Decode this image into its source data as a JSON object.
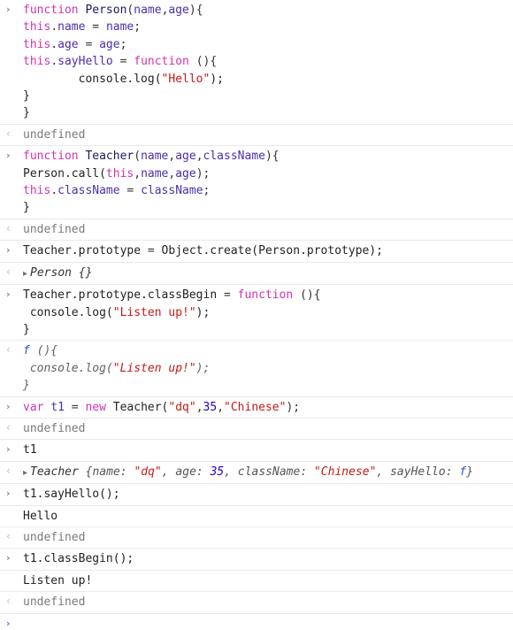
{
  "app": {
    "name": "browser-devtools-console",
    "theme": "light"
  },
  "colors": {
    "background": "#ffffff",
    "keyword": "#d033b5",
    "identifier": "#4b2fa8",
    "function_name": "#1a1a5e",
    "string": "#c41a16",
    "number": "#1c00cf",
    "plain_text": "#222222",
    "result_gray": "#7a7a7a",
    "separator": "#eaeaea",
    "prompt_blue": "#4a7fe0"
  },
  "icons": {
    "input_prompt": "›",
    "output_prompt": "‹",
    "disclosure_triangle": "▸"
  },
  "console": {
    "entries": [
      {
        "kind": "input",
        "gutter": "input-prompt-icon",
        "lines": [
          {
            "tokens": [
              {
                "t": "function",
                "c": "kw"
              },
              {
                "t": " ",
                "c": "plain"
              },
              {
                "t": "Person",
                "c": "fname"
              },
              {
                "t": "(",
                "c": "punct"
              },
              {
                "t": "name",
                "c": "ident"
              },
              {
                "t": ",",
                "c": "punct"
              },
              {
                "t": "age",
                "c": "ident"
              },
              {
                "t": "){",
                "c": "punct"
              }
            ]
          },
          {
            "tokens": [
              {
                "t": "this",
                "c": "kw"
              },
              {
                "t": ".",
                "c": "punct"
              },
              {
                "t": "name",
                "c": "ident"
              },
              {
                "t": " = ",
                "c": "punct"
              },
              {
                "t": "name",
                "c": "ident"
              },
              {
                "t": ";",
                "c": "punct"
              }
            ]
          },
          {
            "tokens": [
              {
                "t": "this",
                "c": "kw"
              },
              {
                "t": ".",
                "c": "punct"
              },
              {
                "t": "age",
                "c": "ident"
              },
              {
                "t": " = ",
                "c": "punct"
              },
              {
                "t": "age",
                "c": "ident"
              },
              {
                "t": ";",
                "c": "punct"
              }
            ]
          },
          {
            "tokens": [
              {
                "t": "this",
                "c": "kw"
              },
              {
                "t": ".",
                "c": "punct"
              },
              {
                "t": "sayHello",
                "c": "ident"
              },
              {
                "t": " = ",
                "c": "punct"
              },
              {
                "t": "function",
                "c": "kw"
              },
              {
                "t": " (){",
                "c": "punct"
              }
            ]
          },
          {
            "tokens": [
              {
                "t": "        console.log(",
                "c": "plain"
              },
              {
                "t": "\"Hello\"",
                "c": "str"
              },
              {
                "t": ");",
                "c": "plain"
              }
            ]
          },
          {
            "tokens": [
              {
                "t": "}",
                "c": "plain"
              }
            ]
          },
          {
            "tokens": [
              {
                "t": "}",
                "c": "plain"
              }
            ]
          }
        ]
      },
      {
        "kind": "result",
        "gutter": "output-prompt-icon",
        "text": "undefined",
        "style": "undefined"
      },
      {
        "kind": "input",
        "gutter": "input-prompt-icon",
        "lines": [
          {
            "tokens": [
              {
                "t": "function",
                "c": "kw"
              },
              {
                "t": " ",
                "c": "plain"
              },
              {
                "t": "Teacher",
                "c": "fname"
              },
              {
                "t": "(",
                "c": "punct"
              },
              {
                "t": "name",
                "c": "ident"
              },
              {
                "t": ",",
                "c": "punct"
              },
              {
                "t": "age",
                "c": "ident"
              },
              {
                "t": ",",
                "c": "punct"
              },
              {
                "t": "className",
                "c": "ident"
              },
              {
                "t": "){",
                "c": "punct"
              }
            ]
          },
          {
            "tokens": [
              {
                "t": "Person.call(",
                "c": "plain"
              },
              {
                "t": "this",
                "c": "kw"
              },
              {
                "t": ",",
                "c": "punct"
              },
              {
                "t": "name",
                "c": "ident"
              },
              {
                "t": ",",
                "c": "punct"
              },
              {
                "t": "age",
                "c": "ident"
              },
              {
                "t": ");",
                "c": "punct"
              }
            ]
          },
          {
            "tokens": [
              {
                "t": "this",
                "c": "kw"
              },
              {
                "t": ".",
                "c": "punct"
              },
              {
                "t": "className",
                "c": "ident"
              },
              {
                "t": " = ",
                "c": "punct"
              },
              {
                "t": "className",
                "c": "ident"
              },
              {
                "t": ";",
                "c": "punct"
              }
            ]
          },
          {
            "tokens": [
              {
                "t": "}",
                "c": "plain"
              }
            ]
          }
        ]
      },
      {
        "kind": "result",
        "gutter": "output-prompt-icon",
        "text": "undefined",
        "style": "undefined"
      },
      {
        "kind": "input",
        "gutter": "input-prompt-icon",
        "lines": [
          {
            "tokens": [
              {
                "t": "Teacher.prototype",
                "c": "plain"
              },
              {
                "t": " = ",
                "c": "punct"
              },
              {
                "t": "Object.create(Person.prototype);",
                "c": "plain"
              }
            ]
          }
        ]
      },
      {
        "kind": "result-object",
        "gutter": "output-prompt-icon",
        "object_name": "Person",
        "object_body": "{}"
      },
      {
        "kind": "input",
        "gutter": "input-prompt-icon",
        "lines": [
          {
            "tokens": [
              {
                "t": "Teacher.prototype.classBegin",
                "c": "plain"
              },
              {
                "t": " = ",
                "c": "punct"
              },
              {
                "t": "function",
                "c": "kw"
              },
              {
                "t": " (){",
                "c": "punct"
              }
            ]
          },
          {
            "tokens": [
              {
                "t": " console.log(",
                "c": "plain"
              },
              {
                "t": "\"Listen up!\"",
                "c": "str"
              },
              {
                "t": ");",
                "c": "plain"
              }
            ]
          },
          {
            "tokens": [
              {
                "t": "}",
                "c": "plain"
              }
            ]
          }
        ]
      },
      {
        "kind": "result-function",
        "gutter": "output-prompt-icon",
        "lines": [
          {
            "glyph": "f",
            "rest": " (){"
          },
          {
            "glyph": "",
            "rest": " console.log(\"Listen up!\");",
            "string_part": "\"Listen up!\""
          },
          {
            "glyph": "",
            "rest": "}"
          }
        ]
      },
      {
        "kind": "input",
        "gutter": "input-prompt-icon",
        "lines": [
          {
            "tokens": [
              {
                "t": "var",
                "c": "kw"
              },
              {
                "t": " ",
                "c": "plain"
              },
              {
                "t": "t1",
                "c": "ident"
              },
              {
                "t": " = ",
                "c": "punct"
              },
              {
                "t": "new",
                "c": "kw"
              },
              {
                "t": " Teacher(",
                "c": "plain"
              },
              {
                "t": "\"dq\"",
                "c": "str"
              },
              {
                "t": ",",
                "c": "punct"
              },
              {
                "t": "35",
                "c": "num"
              },
              {
                "t": ",",
                "c": "punct"
              },
              {
                "t": "\"Chinese\"",
                "c": "str"
              },
              {
                "t": ");",
                "c": "punct"
              }
            ]
          }
        ]
      },
      {
        "kind": "result",
        "gutter": "output-prompt-icon",
        "text": "undefined",
        "style": "undefined"
      },
      {
        "kind": "input",
        "gutter": "input-prompt-icon",
        "lines": [
          {
            "tokens": [
              {
                "t": "t1",
                "c": "plain"
              }
            ]
          }
        ]
      },
      {
        "kind": "result-instance",
        "gutter": "output-prompt-icon",
        "class_name": "Teacher",
        "props": [
          {
            "key": "name",
            "value": "\"dq\"",
            "type": "string"
          },
          {
            "key": "age",
            "value": "35",
            "type": "number"
          },
          {
            "key": "className",
            "value": "\"Chinese\"",
            "type": "string"
          },
          {
            "key": "sayHello",
            "value": "f",
            "type": "function"
          }
        ]
      },
      {
        "kind": "input",
        "gutter": "input-prompt-icon",
        "lines": [
          {
            "tokens": [
              {
                "t": "t1.sayHello();",
                "c": "plain"
              }
            ]
          }
        ]
      },
      {
        "kind": "log",
        "gutter": "",
        "text": "Hello"
      },
      {
        "kind": "result",
        "gutter": "output-prompt-icon",
        "text": "undefined",
        "style": "undefined"
      },
      {
        "kind": "input",
        "gutter": "input-prompt-icon",
        "lines": [
          {
            "tokens": [
              {
                "t": "t1.classBegin();",
                "c": "plain"
              }
            ]
          }
        ]
      },
      {
        "kind": "log",
        "gutter": "",
        "text": "Listen up!"
      },
      {
        "kind": "result",
        "gutter": "output-prompt-icon",
        "text": "undefined",
        "style": "undefined"
      },
      {
        "kind": "cursor",
        "gutter": "input-prompt-icon",
        "text": ""
      }
    ]
  }
}
